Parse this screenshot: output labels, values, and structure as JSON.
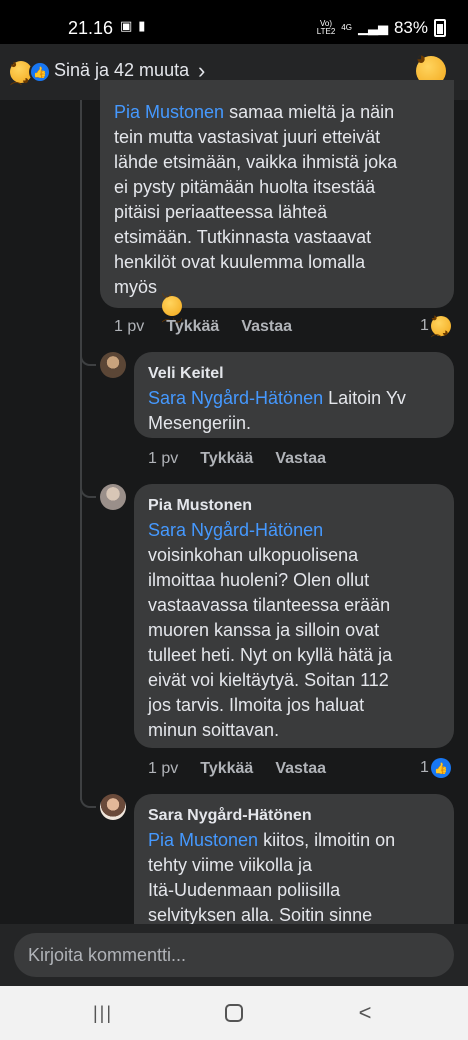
{
  "status_bar": {
    "time": "21.16",
    "network_top": "Vo)",
    "network_bottom": "LTE2",
    "signal_type": "4G",
    "battery": "83%"
  },
  "header": {
    "reactions_text": "Sinä ja 42 muuta",
    "chevron": "›"
  },
  "comments": [
    {
      "id": "c0",
      "mention": "Pia Mustonen",
      "text_lines": [
        " samaa mieltä ja näin",
        "tein mutta vastasivat juuri etteivät",
        "lähde etsimään, vaikka ihmistä joka",
        "ei pysty pitämään huolta itsestää",
        "pitäisi periaatteessa lähteä",
        "etsimään. Tutkinnasta vastaavat",
        "henkilöt ovat kuulemma lomalla",
        "myös "
      ],
      "time": "1 pv",
      "like": "Tykkää",
      "reply": "Vastaa",
      "reaction_count": "1",
      "reaction_icon": "sad-icon"
    },
    {
      "id": "c1",
      "author": "Veli Keitel",
      "mention": "Sara Nygård-Hätönen",
      "text_lines": [
        " Laitoin Yv",
        "Mesengeriin."
      ],
      "time": "1 pv",
      "like": "Tykkää",
      "reply": "Vastaa"
    },
    {
      "id": "c2",
      "author": "Pia Mustonen",
      "mention": "Sara Nygård-Hätönen",
      "text_lines": [
        "voisinkohan ulkopuolisena",
        "ilmoittaa huoleni? Olen ollut",
        "vastaavassa tilanteessa erään",
        "muoren kanssa ja silloin ovat",
        "tulleet heti. Nyt on kyllä hätä ja",
        "eivät voi kieltäytyä. Soitan 112",
        "jos tarvis. Ilmoita jos haluat",
        "minun soittavan."
      ],
      "time": "1 pv",
      "like": "Tykkää",
      "reply": "Vastaa",
      "reaction_count": "1",
      "reaction_icon": "like-icon"
    },
    {
      "id": "c3",
      "author": "Sara Nygård-Hätönen",
      "mention": "Pia Mustonen",
      "text_lines": [
        " kiitos, ilmoitin on",
        "tehty viime viikolla ja",
        "Itä-Uudenmaan poliisilla",
        "selvityksen alla. Soitin sinne"
      ]
    }
  ],
  "composer": {
    "placeholder": "Kirjoita kommentti..."
  },
  "navbar": {
    "recent": "|||",
    "home": "○",
    "back": "<"
  },
  "colors": {
    "background": "#18191a",
    "bubble": "#3a3b3c",
    "mention": "#4599ff",
    "like_blue": "#1877f2"
  }
}
